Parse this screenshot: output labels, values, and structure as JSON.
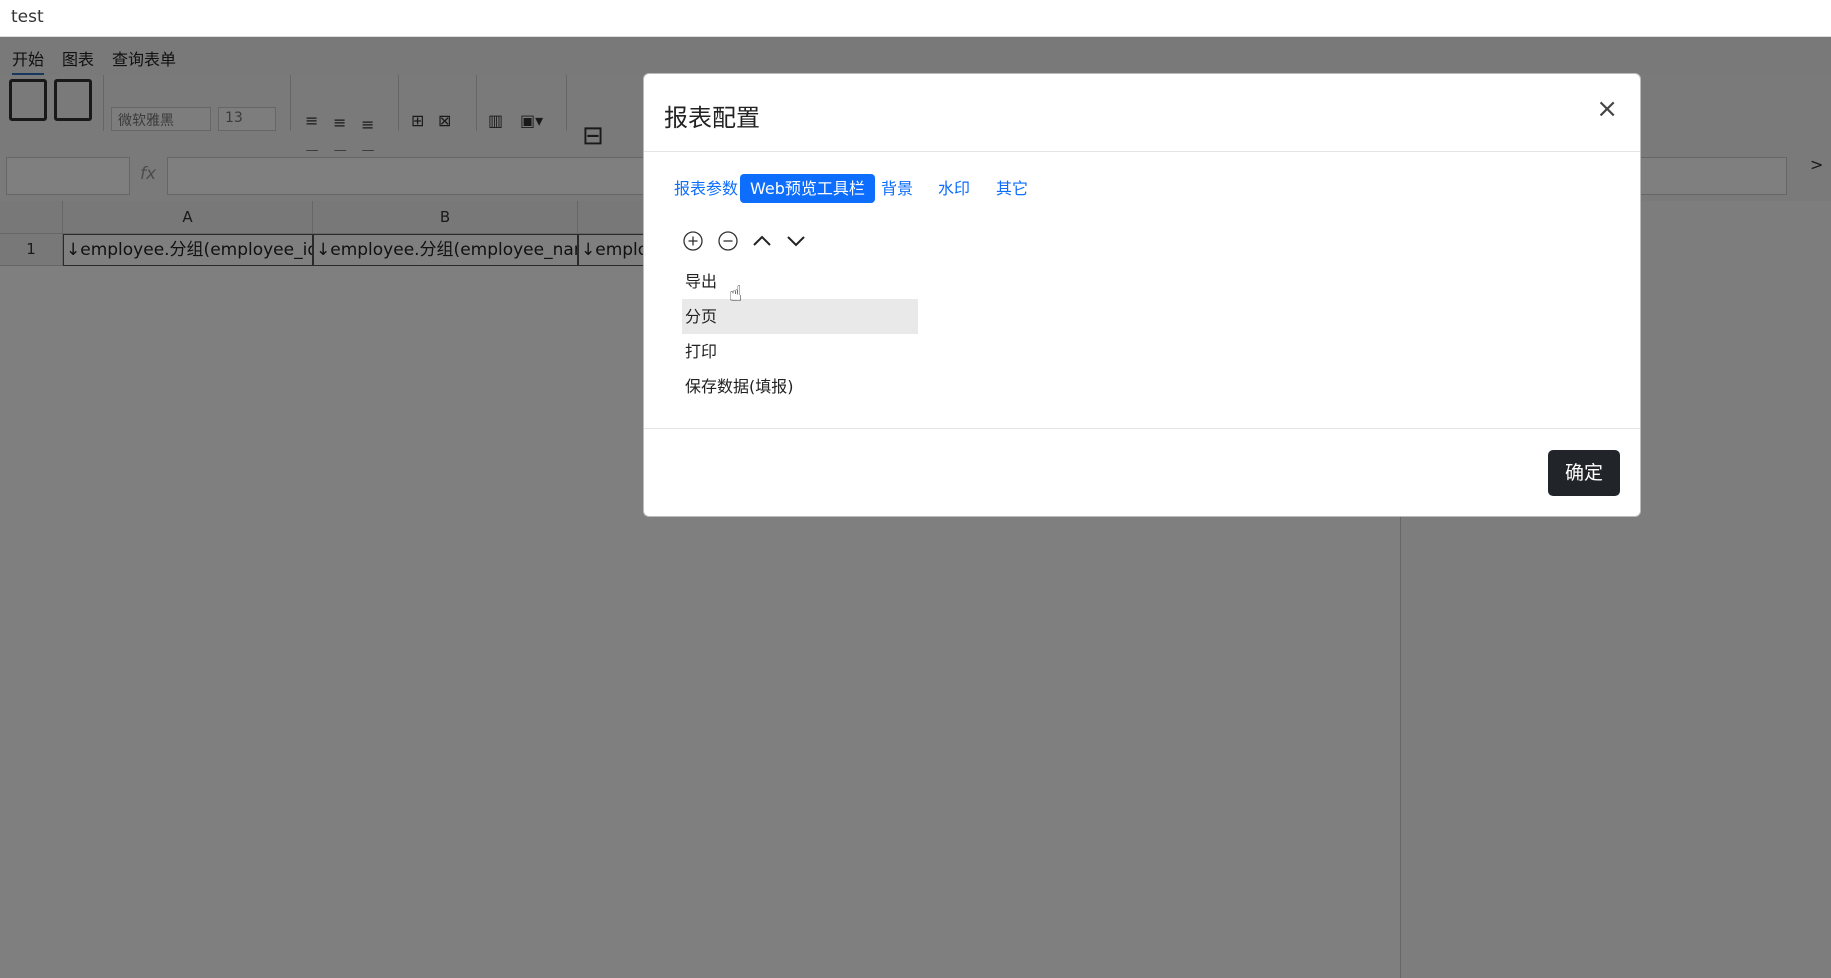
{
  "window": {
    "title": "test"
  },
  "menubar": {
    "items": [
      {
        "label": "开始"
      },
      {
        "label": "图表"
      },
      {
        "label": "查询表单"
      }
    ]
  },
  "toolbar": {
    "font_family": "微软雅黑",
    "font_size": "13"
  },
  "formula_bar": {
    "fx_label": "fx",
    "expand_glyph": ">"
  },
  "sheet": {
    "columns": [
      "A",
      "B"
    ],
    "rows": [
      "1"
    ],
    "cells": [
      "↓employee.分组(employee_id)",
      "↓employee.分组(employee_name)",
      "↓employ"
    ]
  },
  "modal": {
    "title": "报表配置",
    "close_glyph": "×",
    "tabs": [
      {
        "label": "报表参数"
      },
      {
        "label": "Web预览工具栏"
      },
      {
        "label": "背景"
      },
      {
        "label": "水印"
      },
      {
        "label": "其它"
      }
    ],
    "active_tab": "Web预览工具栏",
    "list_items": [
      {
        "label": "导出"
      },
      {
        "label": "分页"
      },
      {
        "label": "打印"
      },
      {
        "label": "保存数据(填报)"
      }
    ],
    "selected_item": "分页",
    "ok_label": "确定"
  },
  "colors": {
    "accent": "#0d6efd",
    "dark_button": "#212529",
    "overlay": "rgba(0,0,0,0.5)",
    "selected_row": "#e9e9e9"
  },
  "icons": {
    "add": "plus-circle-icon",
    "remove": "minus-circle-icon",
    "up": "chevron-up-icon",
    "down": "chevron-down-icon"
  }
}
